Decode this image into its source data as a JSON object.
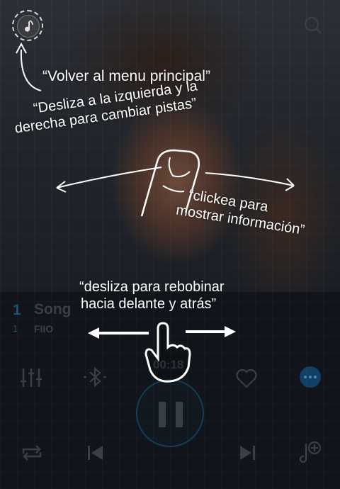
{
  "track": {
    "number": "1",
    "number_sub": "1",
    "title": "Song",
    "artist": "FIIO",
    "elapsed": "00:18"
  },
  "icons": {
    "home": "music-note-icon",
    "search": "search-icon",
    "equalizer": "equalizer-icon",
    "bluetooth": "bluetooth-icon",
    "favorite": "heart-icon",
    "more": "more-dots-icon",
    "pause": "pause-icon",
    "repeat": "repeat-icon",
    "previous": "previous-track-icon",
    "next": "next-track-icon",
    "add_to_playlist": "add-to-playlist-icon"
  },
  "hints": {
    "home_line": "“Volver al menu principal”",
    "swipe_line1": "“Desliza a la izquierda y la",
    "swipe_line2": "derecha para cambiar pistas”",
    "tap_line1": "“clickea para",
    "tap_line2": "mostrar información”",
    "seek_line1": "“desliza para rebobinar",
    "seek_line2": "hacia delante y atrás”"
  },
  "colors": {
    "accent": "#1d4f73",
    "panel": "#11151b",
    "overlay_text": "#ffffff"
  }
}
